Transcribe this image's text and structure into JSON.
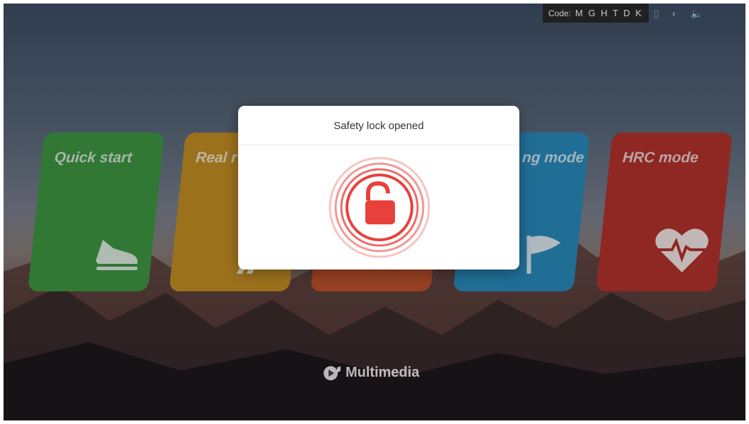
{
  "status_bar": {
    "code_label": "Code:",
    "code_value": "M G H T D K",
    "icons": [
      "thermometer-icon",
      "brightness-icon",
      "volume-icon"
    ]
  },
  "cards": [
    {
      "title": "Quick start",
      "icon": "shoe-icon",
      "color": "#3f9a44"
    },
    {
      "title": "Real r",
      "icon": "runner-icon",
      "color": "#c89124"
    },
    {
      "title": "",
      "icon": "stopwatch-icon",
      "color": "#c2522e"
    },
    {
      "title": "ng mode",
      "icon": "flag-icon",
      "color": "#2a8ec0"
    },
    {
      "title": "HRC mode",
      "icon": "heart-pulse-icon",
      "color": "#b8322e"
    }
  ],
  "footer": {
    "multimedia_label": "Multimedia"
  },
  "dialog": {
    "title": "Safety lock opened",
    "icon": "unlocked-padlock-icon",
    "accent": "#e8413c"
  }
}
